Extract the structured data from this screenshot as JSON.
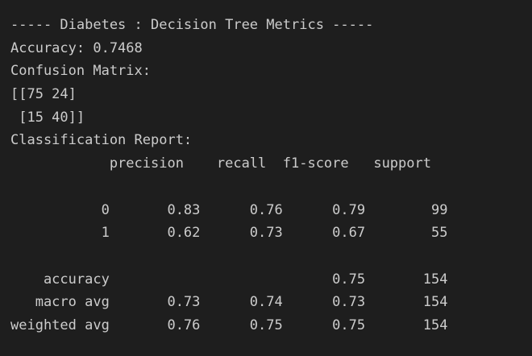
{
  "output": {
    "header": "----- Diabetes : Decision Tree Metrics -----",
    "accuracy_line": "Accuracy: 0.7468",
    "confusion_label": "Confusion Matrix:",
    "matrix_row_1": "[[75 24]",
    "matrix_row_2": " [15 40]]",
    "report_label": "Classification Report:",
    "report_header": "            precision    recall  f1-score   support",
    "blank_1": "",
    "row_0": "           0       0.83      0.76      0.79        99",
    "row_1": "           1       0.62      0.73      0.67        55",
    "blank_2": "",
    "row_accuracy": "    accuracy                           0.75       154",
    "row_macro": "   macro avg       0.73      0.74      0.73       154",
    "row_weighted": "weighted avg       0.76      0.75      0.75       154"
  },
  "colors": {
    "background": "#1e1e1e",
    "text": "#cccccc"
  }
}
